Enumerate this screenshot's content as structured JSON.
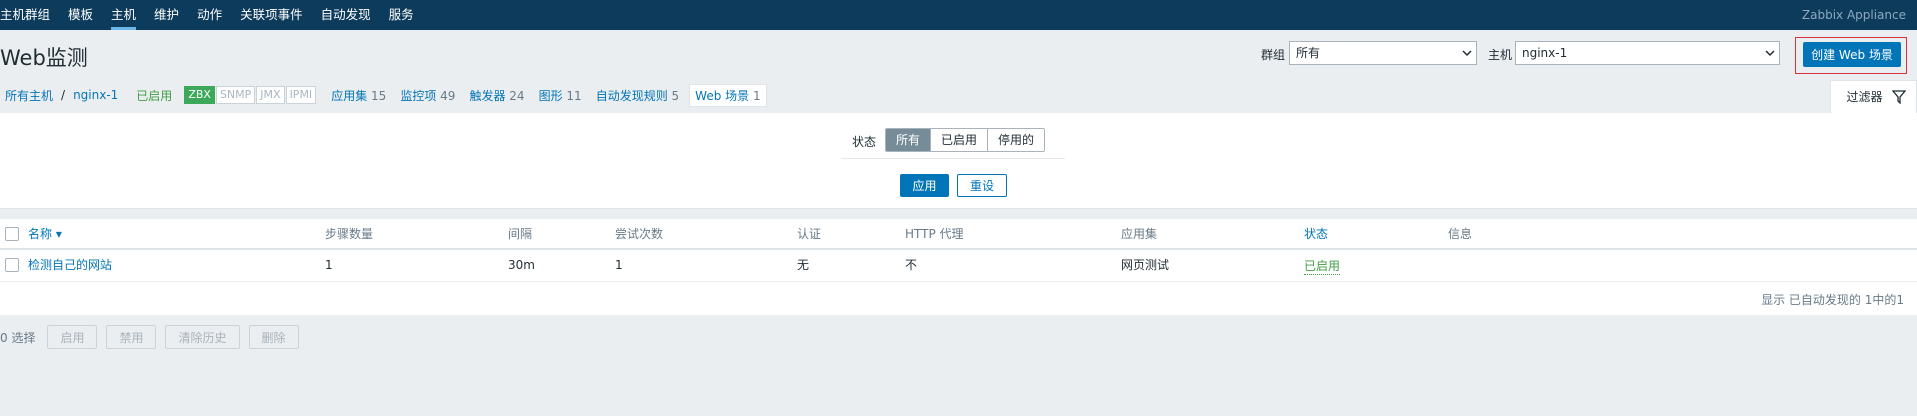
{
  "nav": {
    "items": [
      "主机群组",
      "模板",
      "主机",
      "维护",
      "动作",
      "关联项事件",
      "自动发现",
      "服务"
    ],
    "active_index": 2,
    "brand": "Zabbix Appliance"
  },
  "header": {
    "title": "Web监测",
    "group_label": "群组",
    "group_value": "所有",
    "host_label": "主机",
    "host_value": "nginx-1",
    "create_button": "创建 Web 场景"
  },
  "breadcrumbs": {
    "all_hosts": "所有主机",
    "separator": "/",
    "host": "nginx-1",
    "status": "已启用",
    "tags": [
      {
        "label": "ZBX",
        "active": true
      },
      {
        "label": "SNMP",
        "active": false
      },
      {
        "label": "JMX",
        "active": false
      },
      {
        "label": "IPMI",
        "active": false
      }
    ],
    "links": [
      {
        "label": "应用集",
        "count": "15"
      },
      {
        "label": "监控项",
        "count": "49"
      },
      {
        "label": "触发器",
        "count": "24"
      },
      {
        "label": "图形",
        "count": "11"
      },
      {
        "label": "自动发现规则",
        "count": "5"
      }
    ],
    "active_tab": {
      "label": "Web 场景",
      "count": "1"
    }
  },
  "filter": {
    "tab_label": "过滤器",
    "state_label": "状态",
    "state_options": [
      "所有",
      "已启用",
      "停用的"
    ],
    "selected_state": "所有",
    "apply": "应用",
    "reset": "重设"
  },
  "table": {
    "columns": [
      "名称 ▾",
      "步骤数量",
      "间隔",
      "尝试次数",
      "认证",
      "HTTP 代理",
      "应用集",
      "状态",
      "信息"
    ],
    "rows": [
      [
        "检测自己的网站",
        "1",
        "30m",
        "1",
        "无",
        "不",
        "网页测试",
        "已启用",
        ""
      ]
    ],
    "paging": "显示 已自动发现的 1中的1"
  },
  "actions": {
    "selected": "0 选择",
    "buttons": [
      "启用",
      "禁用",
      "清除历史",
      "删除"
    ]
  },
  "colors": {
    "nav_bg": "#0d3b5c",
    "link": "#0275b8",
    "enabled": "#429e47",
    "highlight_box": "#d8333b"
  }
}
